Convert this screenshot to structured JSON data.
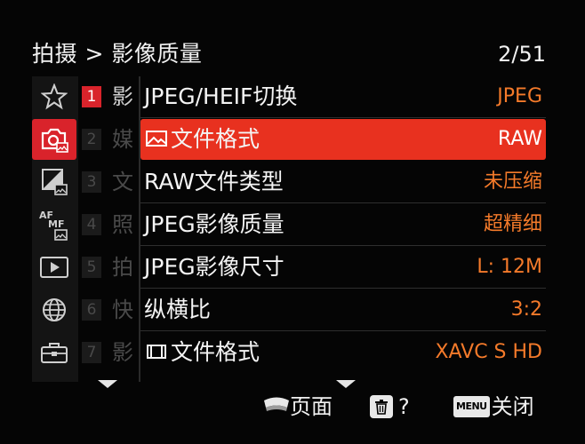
{
  "header": {
    "breadcrumb": "拍摄 > 影像质量",
    "page": "2/51"
  },
  "sidebar": {
    "categories": [
      {
        "icon": "star-icon",
        "active": false
      },
      {
        "icon": "camera-icon",
        "active": true
      },
      {
        "icon": "exposure-color-icon",
        "active": false
      },
      {
        "icon": "af-mf-icon",
        "active": false
      },
      {
        "icon": "playback-icon",
        "active": false
      },
      {
        "icon": "network-globe-icon",
        "active": false
      },
      {
        "icon": "toolbox-icon",
        "active": false
      }
    ]
  },
  "subtabs": [
    {
      "num": "1",
      "char": "影",
      "active": true
    },
    {
      "num": "2",
      "char": "媒",
      "active": false
    },
    {
      "num": "3",
      "char": "文",
      "active": false
    },
    {
      "num": "4",
      "char": "照",
      "active": false
    },
    {
      "num": "5",
      "char": "拍",
      "active": false
    },
    {
      "num": "6",
      "char": "快",
      "active": false
    },
    {
      "num": "7",
      "char": "影",
      "active": false
    }
  ],
  "menu": {
    "rows": [
      {
        "label": "JPEG/HEIF切换",
        "value": "JPEG"
      },
      {
        "label": "文件格式",
        "value": "RAW",
        "icon": "still-image-icon"
      },
      {
        "label": "RAW文件类型",
        "value": "未压缩"
      },
      {
        "label": "JPEG影像质量",
        "value": "超精细"
      },
      {
        "label": "JPEG影像尺寸",
        "value": "L: 12M"
      },
      {
        "label": "纵横比",
        "value": "3:2"
      },
      {
        "label": "文件格式",
        "value": "XAVC S HD",
        "icon": "movie-icon"
      }
    ],
    "selected_index": 1
  },
  "footer": {
    "page_label": "页面",
    "help_label": "?",
    "menu_key": "MENU",
    "close_label": "关闭"
  },
  "colors": {
    "accent_red": "#d9232b",
    "selected_row": "#e8311f",
    "value_orange": "#f47a2a"
  }
}
